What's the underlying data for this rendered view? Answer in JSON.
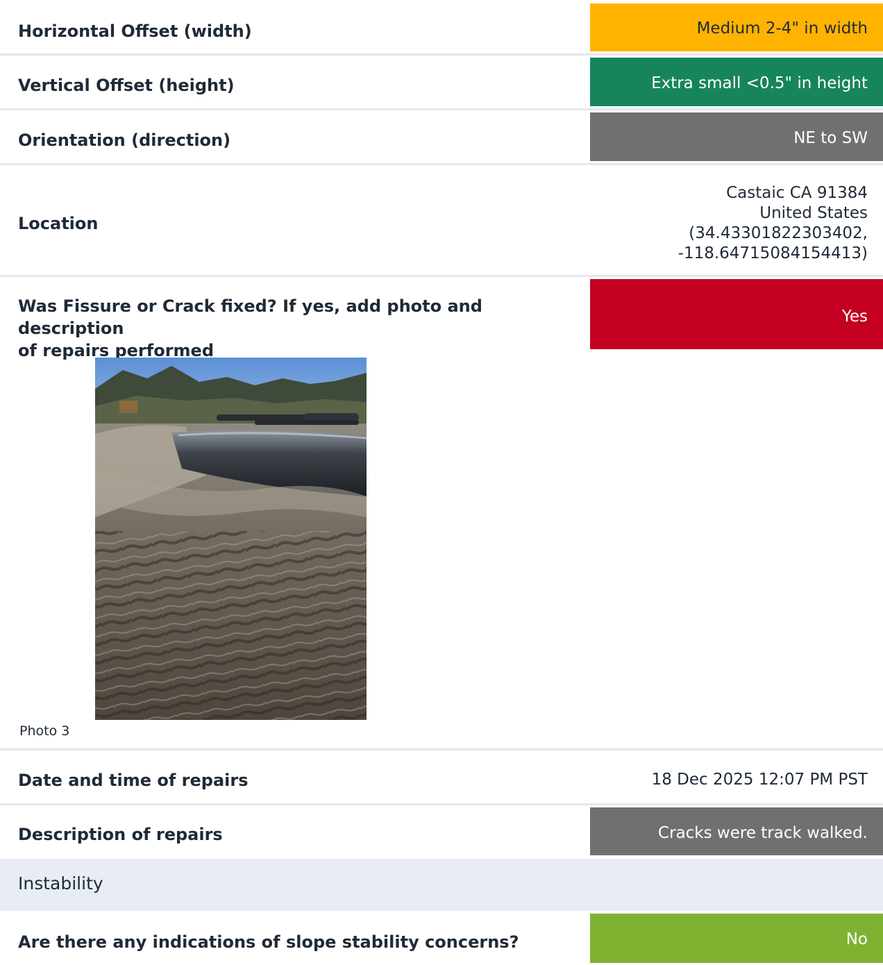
{
  "rows": {
    "horizontal": {
      "label": "Horizontal Offset (width)",
      "value": "Medium 2-4\" in width",
      "color": "#ffb300"
    },
    "vertical": {
      "label": "Vertical Offset (height)",
      "value": "Extra small <0.5\" in height",
      "color": "#17855c"
    },
    "orientation": {
      "label": "Orientation (direction)",
      "value": "NE to SW",
      "color": "#707070"
    },
    "location": {
      "label": "Location",
      "lines": [
        "Castaic CA 91384",
        "United States",
        "(34.43301822303402,",
        "-118.64715084154413)"
      ]
    },
    "fixed": {
      "label_line1": "Was Fissure or Crack fixed? If yes, add photo and description",
      "label_line2": "of repairs performed",
      "value": "Yes",
      "color": "#c40022"
    },
    "photo": {
      "caption": "Photo 3",
      "icon": "photo-image"
    },
    "date": {
      "label": "Date and time of repairs",
      "value": "18 Dec 2025 12:07 PM PST"
    },
    "description": {
      "label": "Description of repairs",
      "value": "Cracks were track walked.",
      "color": "#707070"
    },
    "section": {
      "title": "Instability"
    },
    "slope": {
      "label": "Are there any indications of slope stability concerns?",
      "value": "No",
      "color": "#7fb231"
    }
  }
}
